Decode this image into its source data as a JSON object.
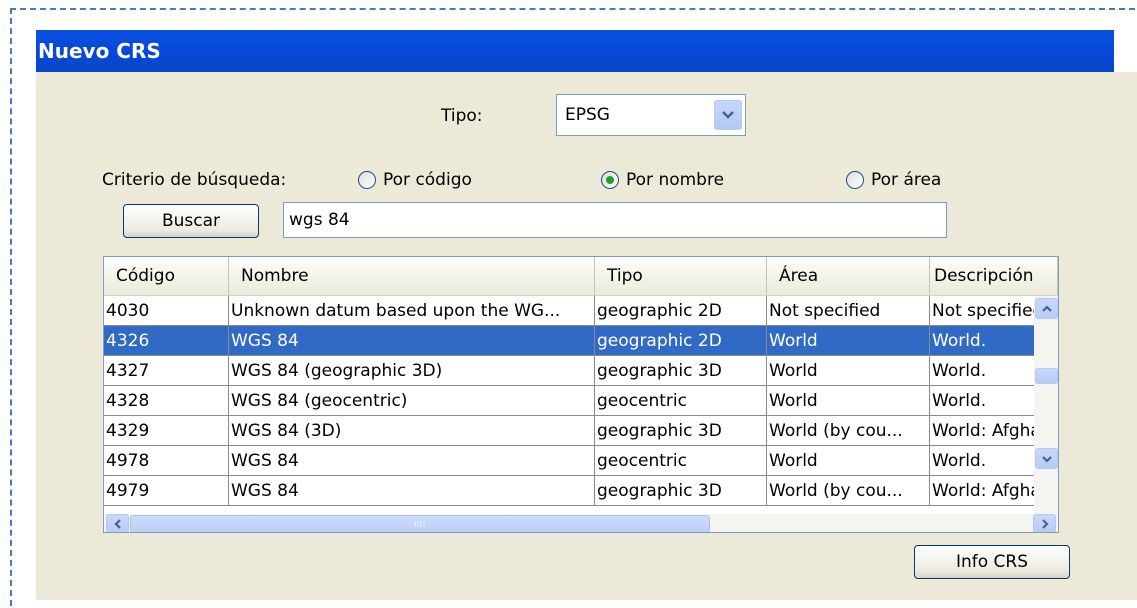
{
  "window": {
    "title": "Nuevo CRS"
  },
  "tipo": {
    "label": "Tipo:",
    "value": "EPSG"
  },
  "search_criteria": {
    "label": "Criterio de búsqueda:",
    "options": [
      {
        "label": "Por código",
        "checked": false
      },
      {
        "label": "Por nombre",
        "checked": true
      },
      {
        "label": "Por área",
        "checked": false
      }
    ]
  },
  "search": {
    "button_label": "Buscar",
    "value": "wgs 84"
  },
  "table": {
    "columns": [
      "Código",
      "Nombre",
      "Tipo",
      "Área",
      "Descripción"
    ],
    "rows": [
      [
        "4030",
        "Unknown datum based upon the WG...",
        "geographic 2D",
        "Not specified",
        "Not specified"
      ],
      [
        "4326",
        "WGS 84",
        "geographic 2D",
        "World",
        "World."
      ],
      [
        "4327",
        "WGS 84 (geographic 3D)",
        "geographic 3D",
        "World",
        "World."
      ],
      [
        "4328",
        "WGS 84 (geocentric)",
        "geocentric",
        "World",
        "World."
      ],
      [
        "4329",
        "WGS 84 (3D)",
        "geographic 3D",
        "World (by cou...",
        "World: Afgha"
      ],
      [
        "4978",
        "WGS 84",
        "geocentric",
        "World",
        "World."
      ],
      [
        "4979",
        "WGS 84",
        "geographic 3D",
        "World (by cou...",
        "World: Afgha"
      ]
    ],
    "selected_index": 1
  },
  "info_button": {
    "label": "Info CRS"
  },
  "icons": {
    "dropdown": "chevron-down-icon",
    "scroll_up": "chevron-up-icon",
    "scroll_down": "chevron-down-icon",
    "scroll_left": "chevron-left-icon",
    "scroll_right": "chevron-right-icon"
  },
  "colors": {
    "titlebar": "#0a52e4",
    "selection": "#316ac5",
    "dialog_bg": "#ece9d8"
  }
}
